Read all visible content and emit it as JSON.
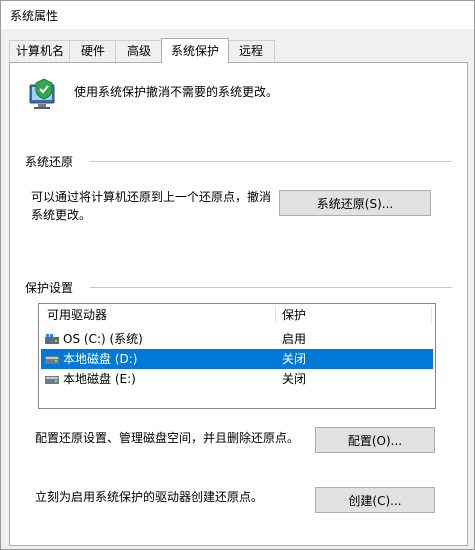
{
  "window": {
    "title": "系统属性"
  },
  "tabs": [
    {
      "label": "计算机名"
    },
    {
      "label": "硬件"
    },
    {
      "label": "高级"
    },
    {
      "label": "系统保护",
      "active": true
    },
    {
      "label": "远程"
    }
  ],
  "intro": {
    "text": "使用系统保护撤消不需要的系统更改。",
    "icon": "system-protection-icon"
  },
  "restore": {
    "group_label": "系统还原",
    "desc_line1": "可以通过将计算机还原到上一个还原点，撤消",
    "desc_line2": "系统更改。",
    "button_label": "系统还原(S)..."
  },
  "protection": {
    "group_label": "保护设置",
    "columns": {
      "drive": "可用驱动器",
      "protect": "保护"
    },
    "drives": [
      {
        "name": "OS (C:) (系统)",
        "status": "启用",
        "icon": "system-drive-icon",
        "selected": false
      },
      {
        "name": "本地磁盘 (D:)",
        "status": "关闭",
        "icon": "local-drive-icon",
        "selected": true
      },
      {
        "name": "本地磁盘 (E:)",
        "status": "关闭",
        "icon": "local-drive-icon",
        "selected": false
      }
    ],
    "config_desc": "配置还原设置、管理磁盘空间，并且删除还原点。",
    "config_button": "配置(O)...",
    "create_desc": "立刻为启用系统保护的驱动器创建还原点。",
    "create_button": "创建(C)..."
  },
  "colors": {
    "selection": "#0078d7",
    "button_face": "#e1e1e1"
  }
}
